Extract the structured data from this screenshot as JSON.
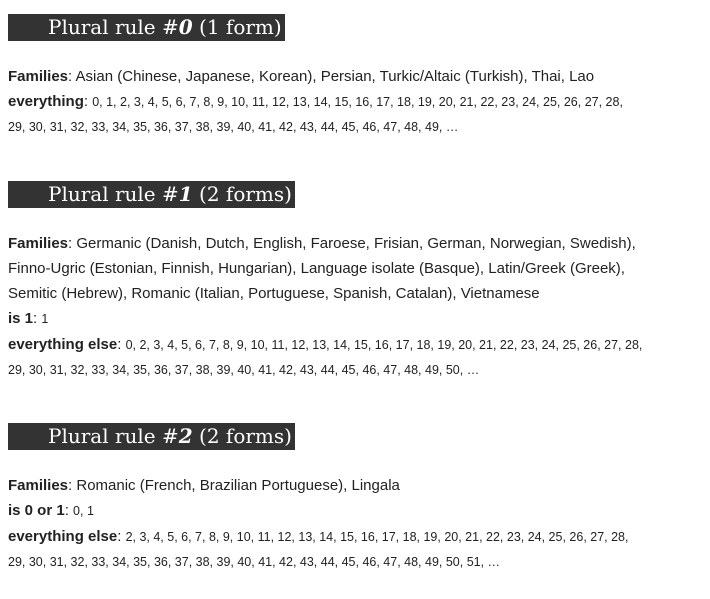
{
  "rules": [
    {
      "title_prefix": "Plural rule #",
      "number": "0",
      "forms": "(1 form)",
      "families_label": "Families",
      "families_text": "Asian (Chinese, Japanese, Korean), Persian, Turkic/Altaic (Turkish), Thai, Lao",
      "categories": [
        {
          "label": "everything",
          "values_line1": "0, 1, 2, 3, 4, 5, 6, 7, 8, 9, 10, 11, 12, 13, 14, 15, 16, 17, 18, 19, 20, 21, 22, 23, 24, 25, 26, 27, 28,",
          "values_line2": "29, 30, 31, 32, 33, 34, 35, 36, 37, 38, 39, 40, 41, 42, 43, 44, 45, 46, 47, 48, 49, …"
        }
      ]
    },
    {
      "title_prefix": "Plural rule #",
      "number": "1",
      "forms": "(2 forms)",
      "families_label": "Families",
      "families_text_line1": "Germanic (Danish, Dutch, English, Faroese, Frisian, German, Norwegian, Swedish),",
      "families_text_line2": "Finno-Ugric (Estonian, Finnish, Hungarian), Language isolate (Basque), Latin/Greek (Greek),",
      "families_text_line3": "Semitic (Hebrew), Romanic (Italian, Portuguese, Spanish, Catalan), Vietnamese",
      "categories": [
        {
          "label": "is 1",
          "values_line1": "1"
        },
        {
          "label": "everything else",
          "values_line1": "0, 2, 3, 4, 5, 6, 7, 8, 9, 10, 11, 12, 13, 14, 15, 16, 17, 18, 19, 20, 21, 22, 23, 24, 25, 26, 27, 28,",
          "values_line2": "29, 30, 31, 32, 33, 34, 35, 36, 37, 38, 39, 40, 41, 42, 43, 44, 45, 46, 47, 48, 49, 50, …"
        }
      ]
    },
    {
      "title_prefix": "Plural rule #",
      "number": "2",
      "forms": "(2 forms)",
      "families_label": "Families",
      "families_text": "Romanic (French, Brazilian Portuguese), Lingala",
      "categories": [
        {
          "label": "is 0 or 1",
          "values_line1": "0, 1"
        },
        {
          "label": "everything else",
          "values_line1": "2, 3, 4, 5, 6, 7, 8, 9, 10, 11, 12, 13, 14, 15, 16, 17, 18, 19, 20, 21, 22, 23, 24, 25, 26, 27, 28,",
          "values_line2": "29, 30, 31, 32, 33, 34, 35, 36, 37, 38, 39, 40, 41, 42, 43, 44, 45, 46, 47, 48, 49, 50, 51, …"
        }
      ]
    }
  ]
}
